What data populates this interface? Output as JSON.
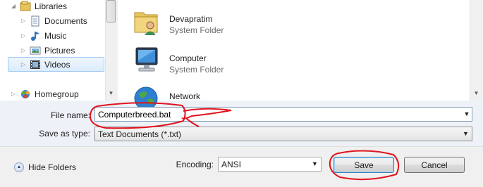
{
  "nav": {
    "items": [
      {
        "label": "Libraries",
        "icon": "libraries-icon",
        "expanded": true
      },
      {
        "label": "Documents",
        "icon": "documents-library-icon"
      },
      {
        "label": "Music",
        "icon": "music-library-icon"
      },
      {
        "label": "Pictures",
        "icon": "pictures-library-icon"
      },
      {
        "label": "Videos",
        "icon": "videos-library-icon",
        "selected": true
      },
      {
        "label": "Homegroup",
        "icon": "homegroup-icon"
      }
    ]
  },
  "files": {
    "items": [
      {
        "name": "Devapratim",
        "type": "System Folder",
        "icon": "user-folder-icon"
      },
      {
        "name": "Computer",
        "type": "System Folder",
        "icon": "computer-icon"
      },
      {
        "name": "Network",
        "type": "",
        "icon": "network-icon"
      }
    ]
  },
  "form": {
    "filename_label": "File name:",
    "filename_value": "Computerbreed.bat",
    "savetype_label": "Save as type:",
    "savetype_value": "Text Documents (*.txt)",
    "encoding_label": "Encoding:",
    "encoding_value": "ANSI"
  },
  "buttons": {
    "hide_folders": "Hide Folders",
    "save": "Save",
    "cancel": "Cancel"
  },
  "colors": {
    "annotation": "#e0141e",
    "selection": "#dcecfd",
    "save_border": "#3c7fb1"
  }
}
